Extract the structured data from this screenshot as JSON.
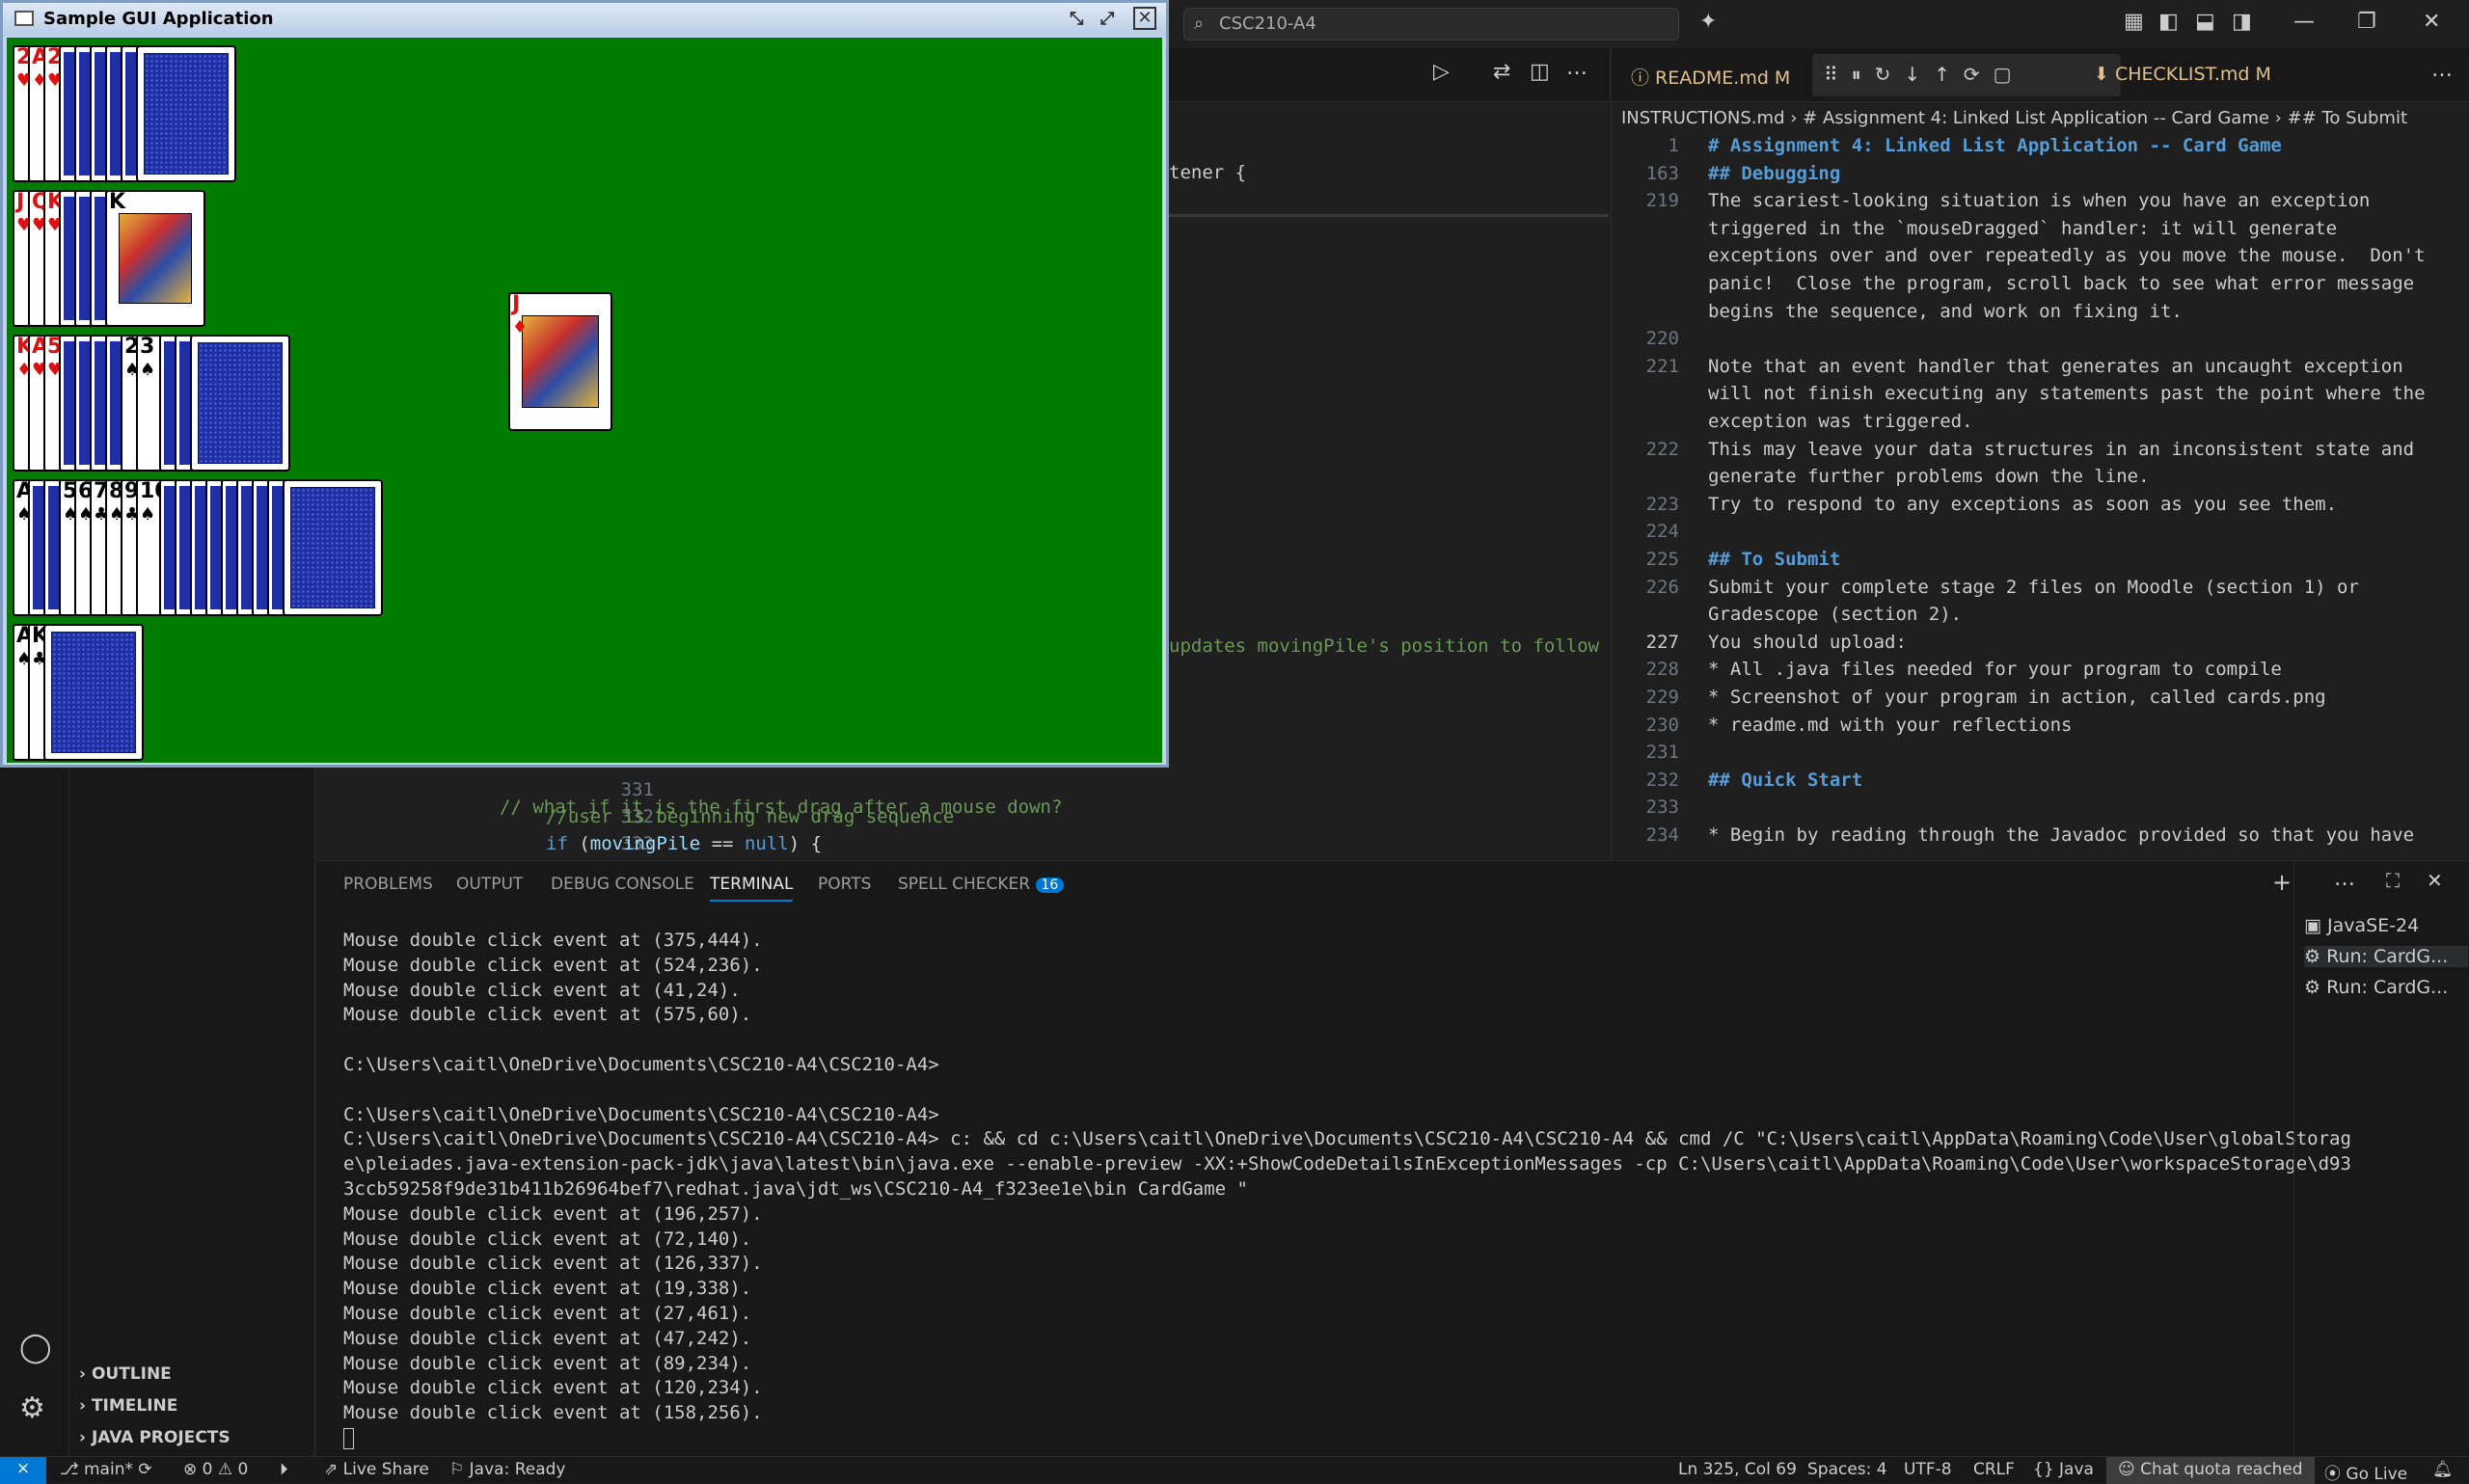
{
  "window": {
    "search": "CSC210-A4"
  },
  "java_window": {
    "title": "Sample GUI Application",
    "piles": [
      {
        "ranks": [
          "2",
          "A",
          "2"
        ],
        "suits": [
          "♥",
          "♦",
          "♥"
        ]
      },
      {
        "ranks": [
          "J",
          "Q",
          "K",
          "K"
        ],
        "suits": [
          "♥",
          "♥",
          "♥",
          "♣"
        ]
      },
      {
        "ranks": [
          "K",
          "A",
          "5",
          "2",
          "3"
        ],
        "suits": [
          "♦",
          "♥",
          "♥",
          "♠",
          "♠"
        ]
      },
      {
        "ranks": [
          "A",
          "5",
          "6",
          "7",
          "8",
          "9",
          "10"
        ],
        "suits": [
          "♠",
          "♠",
          "♠",
          "♣",
          "♠",
          "♣",
          "♠"
        ]
      },
      {
        "ranks": [
          "A",
          "K"
        ],
        "suits": [
          "♠",
          "♣"
        ]
      }
    ],
    "moving_card": {
      "rank": "J",
      "suit": "♦"
    }
  },
  "editor_left": {
    "code_fragments": [
      {
        "text": "tener {",
        "line": null
      },
      {
        "text": "updates movingPile's position to follow",
        "line": null
      }
    ],
    "lines": [
      {
        "num": "331",
        "code": ""
      },
      {
        "num": "332",
        "code": "//user is beginning new drag sequence"
      },
      {
        "num": "333",
        "code": "if (movingPile == null) {"
      }
    ],
    "partial_line": "// what if it is the first drag after a mouse down?"
  },
  "editor_right": {
    "tabs": [
      {
        "label": "README.md M"
      },
      {
        "label": "CHECKLIST.md M"
      }
    ],
    "breadcrumb": [
      "INSTRUCTIONS.md",
      "# Assignment 4: Linked List Application -- Card Game",
      "## To Submit"
    ],
    "lines": [
      {
        "num": "1",
        "text": "# Assignment 4: Linked List Application -- Card Game"
      },
      {
        "num": "163",
        "text": "## Debugging"
      },
      {
        "num": "219",
        "text": "The scariest-looking situation is when you have an exception"
      },
      {
        "num": "",
        "text": "triggered in the `mouseDragged` handler: it will generate"
      },
      {
        "num": "",
        "text": "exceptions over and over repeatedly as you move the mouse.  Don't"
      },
      {
        "num": "",
        "text": "panic!  Close the program, scroll back to see what error message"
      },
      {
        "num": "",
        "text": "begins the sequence, and work on fixing it."
      },
      {
        "num": "220",
        "text": ""
      },
      {
        "num": "221",
        "text": "Note that an event handler that generates an uncaught exception"
      },
      {
        "num": "",
        "text": "will not finish executing any statements past the point where the"
      },
      {
        "num": "",
        "text": "exception was triggered."
      },
      {
        "num": "222",
        "text": "This may leave your data structures in an inconsistent state and"
      },
      {
        "num": "",
        "text": "generate further problems down the line."
      },
      {
        "num": "223",
        "text": "Try to respond to any exceptions as soon as you see them."
      },
      {
        "num": "224",
        "text": ""
      },
      {
        "num": "225",
        "text": "## To Submit"
      },
      {
        "num": "226",
        "text": "Submit your complete stage 2 files on Moodle (section 1) or"
      },
      {
        "num": "",
        "text": "Gradescope (section 2)."
      },
      {
        "num": "227",
        "text": "You should upload:"
      },
      {
        "num": "228",
        "text": "* All .java files needed for your program to compile"
      },
      {
        "num": "229",
        "text": "* Screenshot of your program in action, called cards.png"
      },
      {
        "num": "230",
        "text": "* readme.md with your reflections"
      },
      {
        "num": "231",
        "text": ""
      },
      {
        "num": "232",
        "text": "## Quick Start"
      },
      {
        "num": "233",
        "text": ""
      },
      {
        "num": "234",
        "text": "* Begin by reading through the Javadoc provided so that you have"
      }
    ]
  },
  "panel": {
    "tabs": [
      "PROBLEMS",
      "OUTPUT",
      "DEBUG CONSOLE",
      "TERMINAL",
      "PORTS",
      "SPELL CHECKER"
    ],
    "spell_badge": "16",
    "terminal_lines": [
      "Mouse double click event at (375,444).",
      "Mouse double click event at (524,236).",
      "Mouse double click event at (41,24).",
      "Mouse double click event at (575,60).",
      "",
      "C:\\Users\\caitl\\OneDrive\\Documents\\CSC210-A4\\CSC210-A4>",
      "",
      "C:\\Users\\caitl\\OneDrive\\Documents\\CSC210-A4\\CSC210-A4>",
      "C:\\Users\\caitl\\OneDrive\\Documents\\CSC210-A4\\CSC210-A4> c: && cd c:\\Users\\caitl\\OneDrive\\Documents\\CSC210-A4\\CSC210-A4 && cmd /C \"C:\\Users\\caitl\\AppData\\Roaming\\Code\\User\\globalStorag",
      "e\\pleiades.java-extension-pack-jdk\\java\\latest\\bin\\java.exe --enable-preview -XX:+ShowCodeDetailsInExceptionMessages -cp C:\\Users\\caitl\\AppData\\Roaming\\Code\\User\\workspaceStorage\\d93",
      "3ccb59258f9de31b411b26964bef7\\redhat.java\\jdt_ws\\CSC210-A4_f323ee1e\\bin CardGame \"",
      "Mouse double click event at (196,257).",
      "Mouse double click event at (72,140).",
      "Mouse double click event at (126,337).",
      "Mouse double click event at (19,338).",
      "Mouse double click event at (27,461).",
      "Mouse double click event at (47,242).",
      "Mouse double click event at (89,234).",
      "Mouse double click event at (120,234).",
      "Mouse double click event at (158,256)."
    ],
    "terminal_list": [
      "JavaSE-24",
      "Run: CardG...",
      "Run: CardG..."
    ]
  },
  "sidebar": {
    "sections": [
      "OUTLINE",
      "TIMELINE",
      "JAVA PROJECTS"
    ]
  },
  "statusbar": {
    "branch": "main*",
    "errors": "0",
    "warnings": "0",
    "live_share": "Live Share",
    "java_status": "Java: Ready",
    "position": "Ln 325, Col 69",
    "spaces": "Spaces: 4",
    "encoding": "UTF-8",
    "eol": "CRLF",
    "language": "Java",
    "chat": "Chat quota reached",
    "go_live": "Go Live"
  },
  "colors": {
    "accent": "#0078d4",
    "table": "#007d00",
    "card_back": "#1f2fa6"
  }
}
